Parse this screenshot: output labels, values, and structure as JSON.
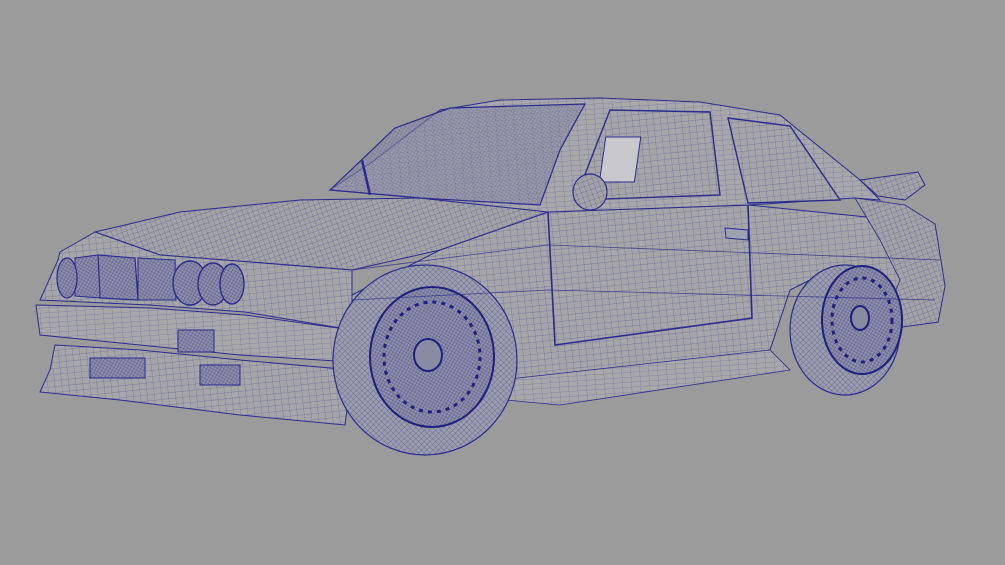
{
  "viewport": {
    "background": "#9b9b9b",
    "wire_color": "#2b2b8f",
    "surface_color": "#a9a9a9"
  }
}
